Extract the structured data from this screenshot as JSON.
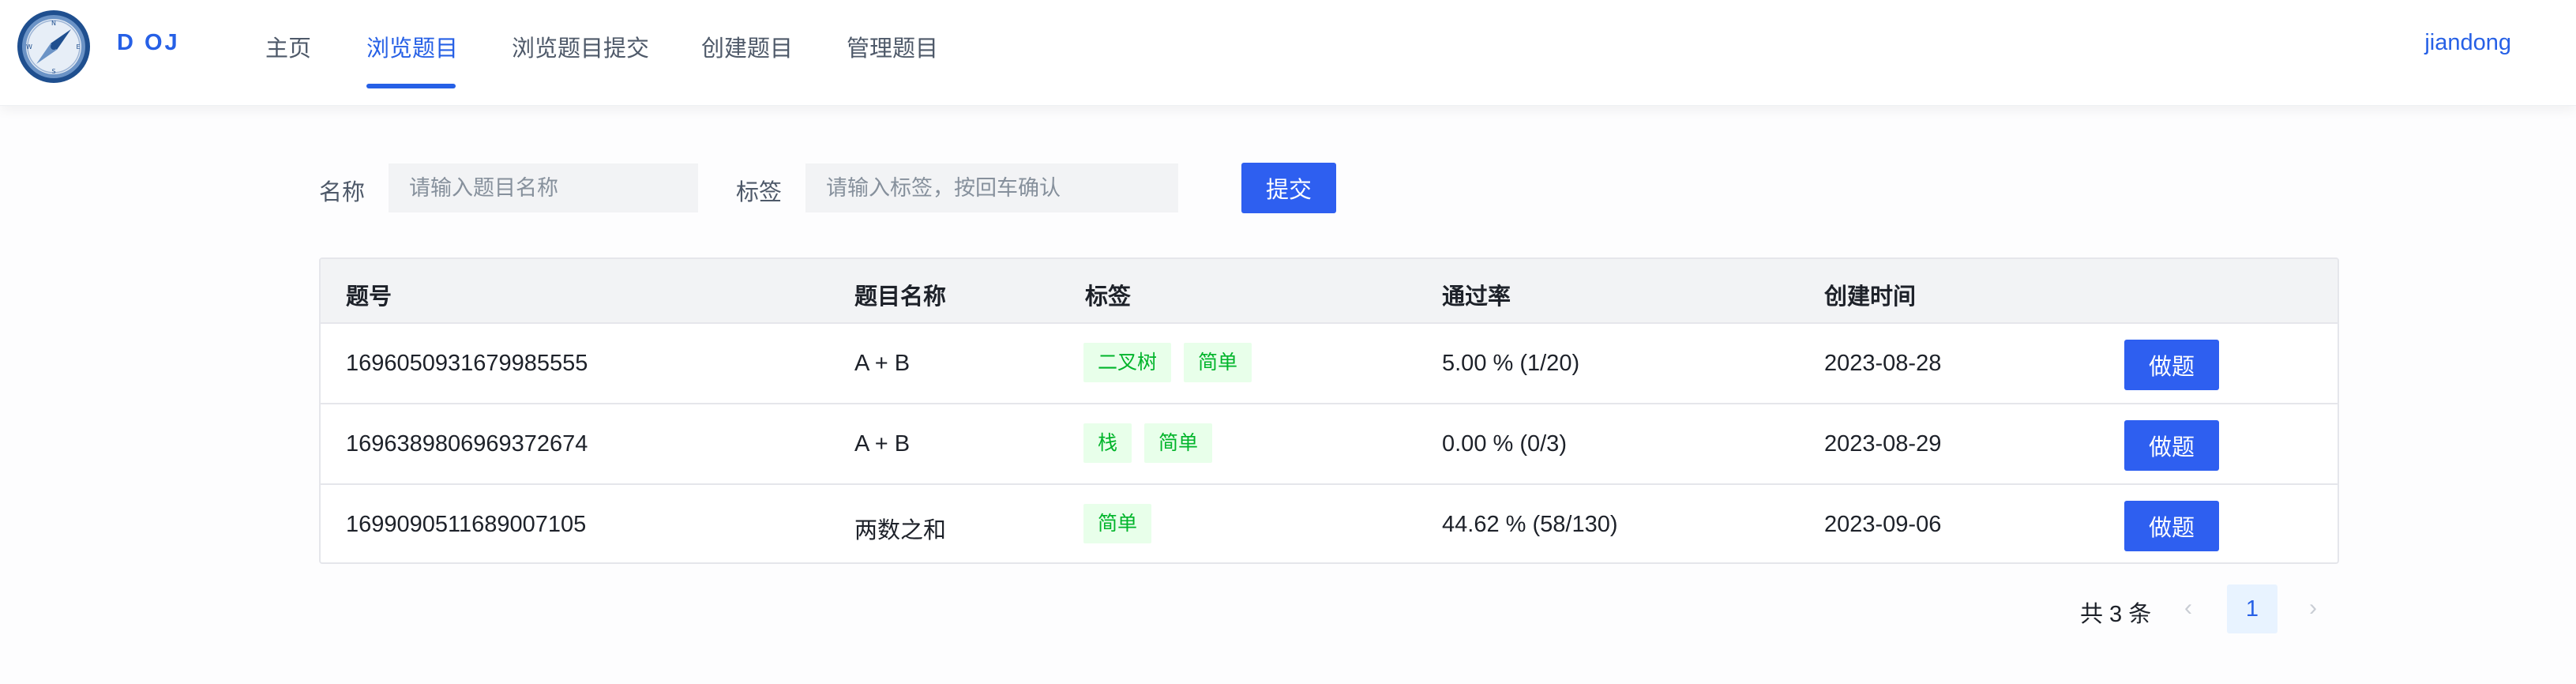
{
  "header": {
    "brand": "D OJ",
    "nav": [
      "主页",
      "浏览题目",
      "浏览题目提交",
      "创建题目",
      "管理题目"
    ],
    "active_nav": "浏览题目",
    "user": "jiandong",
    "logo_icon": "compass-icon"
  },
  "search": {
    "name_label": "名称",
    "name_placeholder": "请输入题目名称",
    "tag_label": "标签",
    "tag_placeholder": "请输入标签，按回车确认",
    "submit_label": "提交"
  },
  "table": {
    "columns": [
      "题号",
      "题目名称",
      "标签",
      "通过率",
      "创建时间"
    ],
    "rows": [
      {
        "id": "1696050931679985555",
        "title": "A + B",
        "tags": [
          "二叉树",
          "简单"
        ],
        "pass_rate": "5.00 % (1/20)",
        "created": "2023-08-28",
        "action": "做题"
      },
      {
        "id": "1696389806969372674",
        "title": "A + B",
        "tags": [
          "栈",
          "简单"
        ],
        "pass_rate": "0.00 % (0/3)",
        "created": "2023-08-29",
        "action": "做题"
      },
      {
        "id": "1699090511689007105",
        "title": "两数之和",
        "tags": [
          "简单"
        ],
        "pass_rate": "44.62 % (58/130)",
        "created": "2023-09-06",
        "action": "做题"
      }
    ]
  },
  "pagination": {
    "total_text": "共 3 条",
    "current_page": "1",
    "prev_icon": "chevron-left-icon",
    "next_icon": "chevron-right-icon"
  },
  "colors": {
    "accent": "#2660e6",
    "button": "#2e5ff0",
    "tag_bg": "#e8ffea",
    "tag_text": "#00b42a",
    "header_bg": "#f2f3f5"
  }
}
